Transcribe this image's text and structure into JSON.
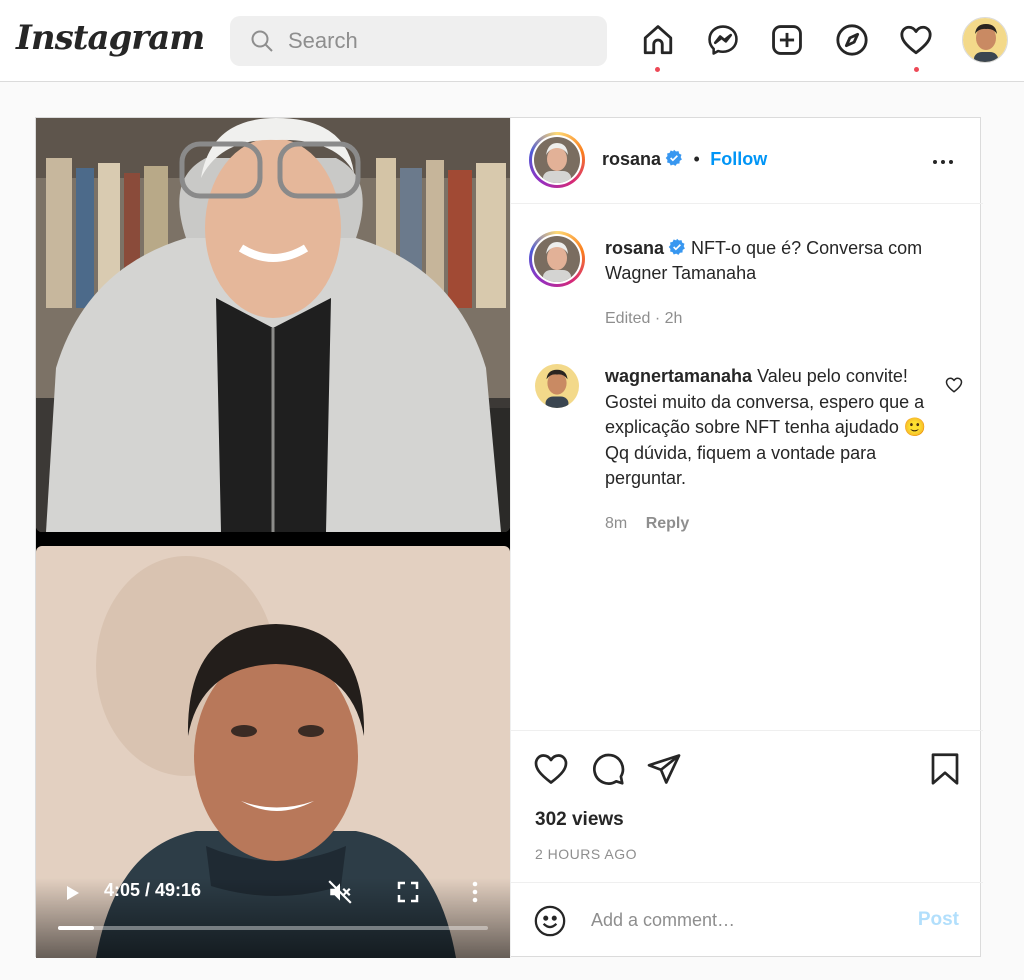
{
  "nav": {
    "logo": "Instagram",
    "search_placeholder": "Search",
    "icons": [
      "home-icon",
      "messenger-icon",
      "new-post-icon",
      "explore-icon",
      "activity-icon"
    ]
  },
  "post": {
    "author": "rosana",
    "follow_label": "Follow",
    "separator": "•",
    "caption": "NFT-o que é? Conversa com Wagner Tamanaha",
    "caption_meta": "Edited · 2h",
    "comment": {
      "author": "wagnertamanaha",
      "text": "Valeu pelo convite! Gostei muito da conversa, espero que a explicação sobre NFT tenha ajudado 🙂 Qq dúvida, fiquem a vontade para perguntar.",
      "age": "8m",
      "reply_label": "Reply"
    },
    "views": "302 views",
    "posted_ago": "2 HOURS AGO",
    "add_comment_placeholder": "Add a comment…",
    "post_label": "Post"
  },
  "video": {
    "time": "4:05 / 49:16",
    "progress": 0.083
  },
  "colors": {
    "link_blue": "#0095f6",
    "notification_red": "#ed4956",
    "post_disabled": "#b2dffc"
  }
}
